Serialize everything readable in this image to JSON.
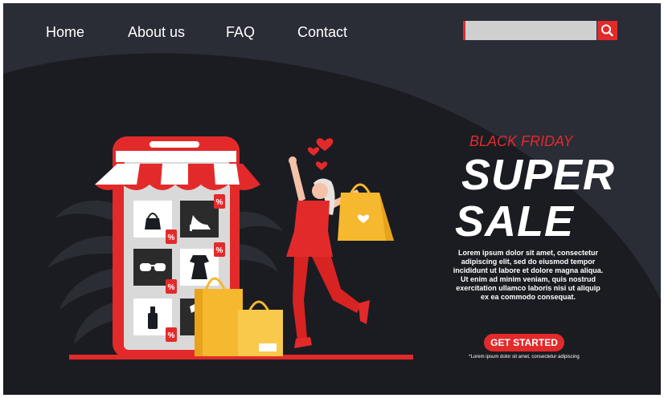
{
  "nav": {
    "items": [
      {
        "id": "home",
        "label": "Home"
      },
      {
        "id": "about",
        "label": "About us"
      },
      {
        "id": "faq",
        "label": "FAQ"
      },
      {
        "id": "contact",
        "label": "Contact"
      }
    ]
  },
  "search": {
    "value": "",
    "placeholder": "",
    "icon": "search-icon"
  },
  "hero": {
    "eyebrow": "BLACK FRIDAY",
    "title_line1": "SUPER",
    "title_line2": "SALE",
    "body": "Lorem ipsum dolor sit amet, consectetur adipiscing elit, sed do eiusmod tempor incididunt ut labore et dolore magna aliqua. Ut enim ad minim veniam, quis nostrud exercitation ullamco laboris nisi ut aliquip ex ea commodo consequat.",
    "cta_label": "GET STARTED",
    "cta_note": "*Lorem ipsum dolor sit amet, consectetur adipiscing"
  },
  "colors": {
    "background": "#1b1c22",
    "accent": "#e32a2a",
    "bag_yellow": "#f5b82e"
  },
  "illustration": {
    "tags": [
      "%",
      "%",
      "%",
      "%",
      "%"
    ],
    "icons": [
      "handbag-icon",
      "high-heel-icon",
      "sunglasses-icon",
      "dress-icon",
      "perfume-icon",
      "shirt-icon"
    ]
  }
}
